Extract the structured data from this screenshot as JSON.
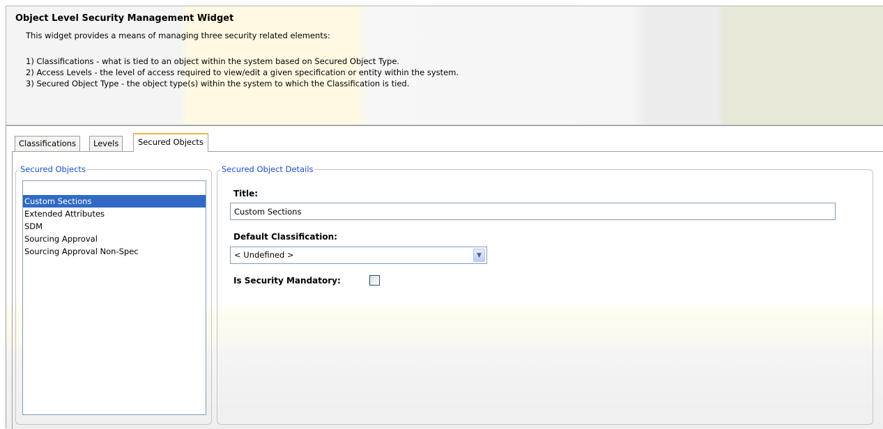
{
  "header": {
    "title": "Object Level Security Management Widget",
    "intro": "This widget provides a means of managing three security related elements:",
    "items": [
      "1) Classifications - what is tied to an object within the system based on Secured Object Type.",
      "2) Access Levels - the level of access required to view/edit a given specification or entity within the system.",
      "3) Secured Object Type - the object type(s) within the system to which the Classification is tied."
    ]
  },
  "tabs": [
    {
      "label": "Classifications",
      "active": false
    },
    {
      "label": "Levels",
      "active": false
    },
    {
      "label": "Secured Objects",
      "active": true
    }
  ],
  "secured_objects": {
    "legend": "Secured Objects",
    "items": [
      {
        "label": "Custom Sections",
        "selected": true
      },
      {
        "label": "Extended Attributes",
        "selected": false
      },
      {
        "label": "SDM",
        "selected": false
      },
      {
        "label": "Sourcing Approval",
        "selected": false
      },
      {
        "label": "Sourcing Approval Non-Spec",
        "selected": false
      }
    ]
  },
  "details": {
    "legend": "Secured Object Details",
    "title_label": "Title:",
    "title_value": "Custom Sections",
    "default_classification_label": "Default Classification:",
    "default_classification_value": "< Undefined >",
    "is_security_mandatory_label": "Is Security Mandatory:",
    "is_security_mandatory_checked": false
  },
  "colors": {
    "legend_text": "#1b4fd1",
    "selection": "#316ac5",
    "active_tab_accent": "#f1b63a"
  },
  "icons": {
    "dropdown": "chevron-down-icon"
  }
}
